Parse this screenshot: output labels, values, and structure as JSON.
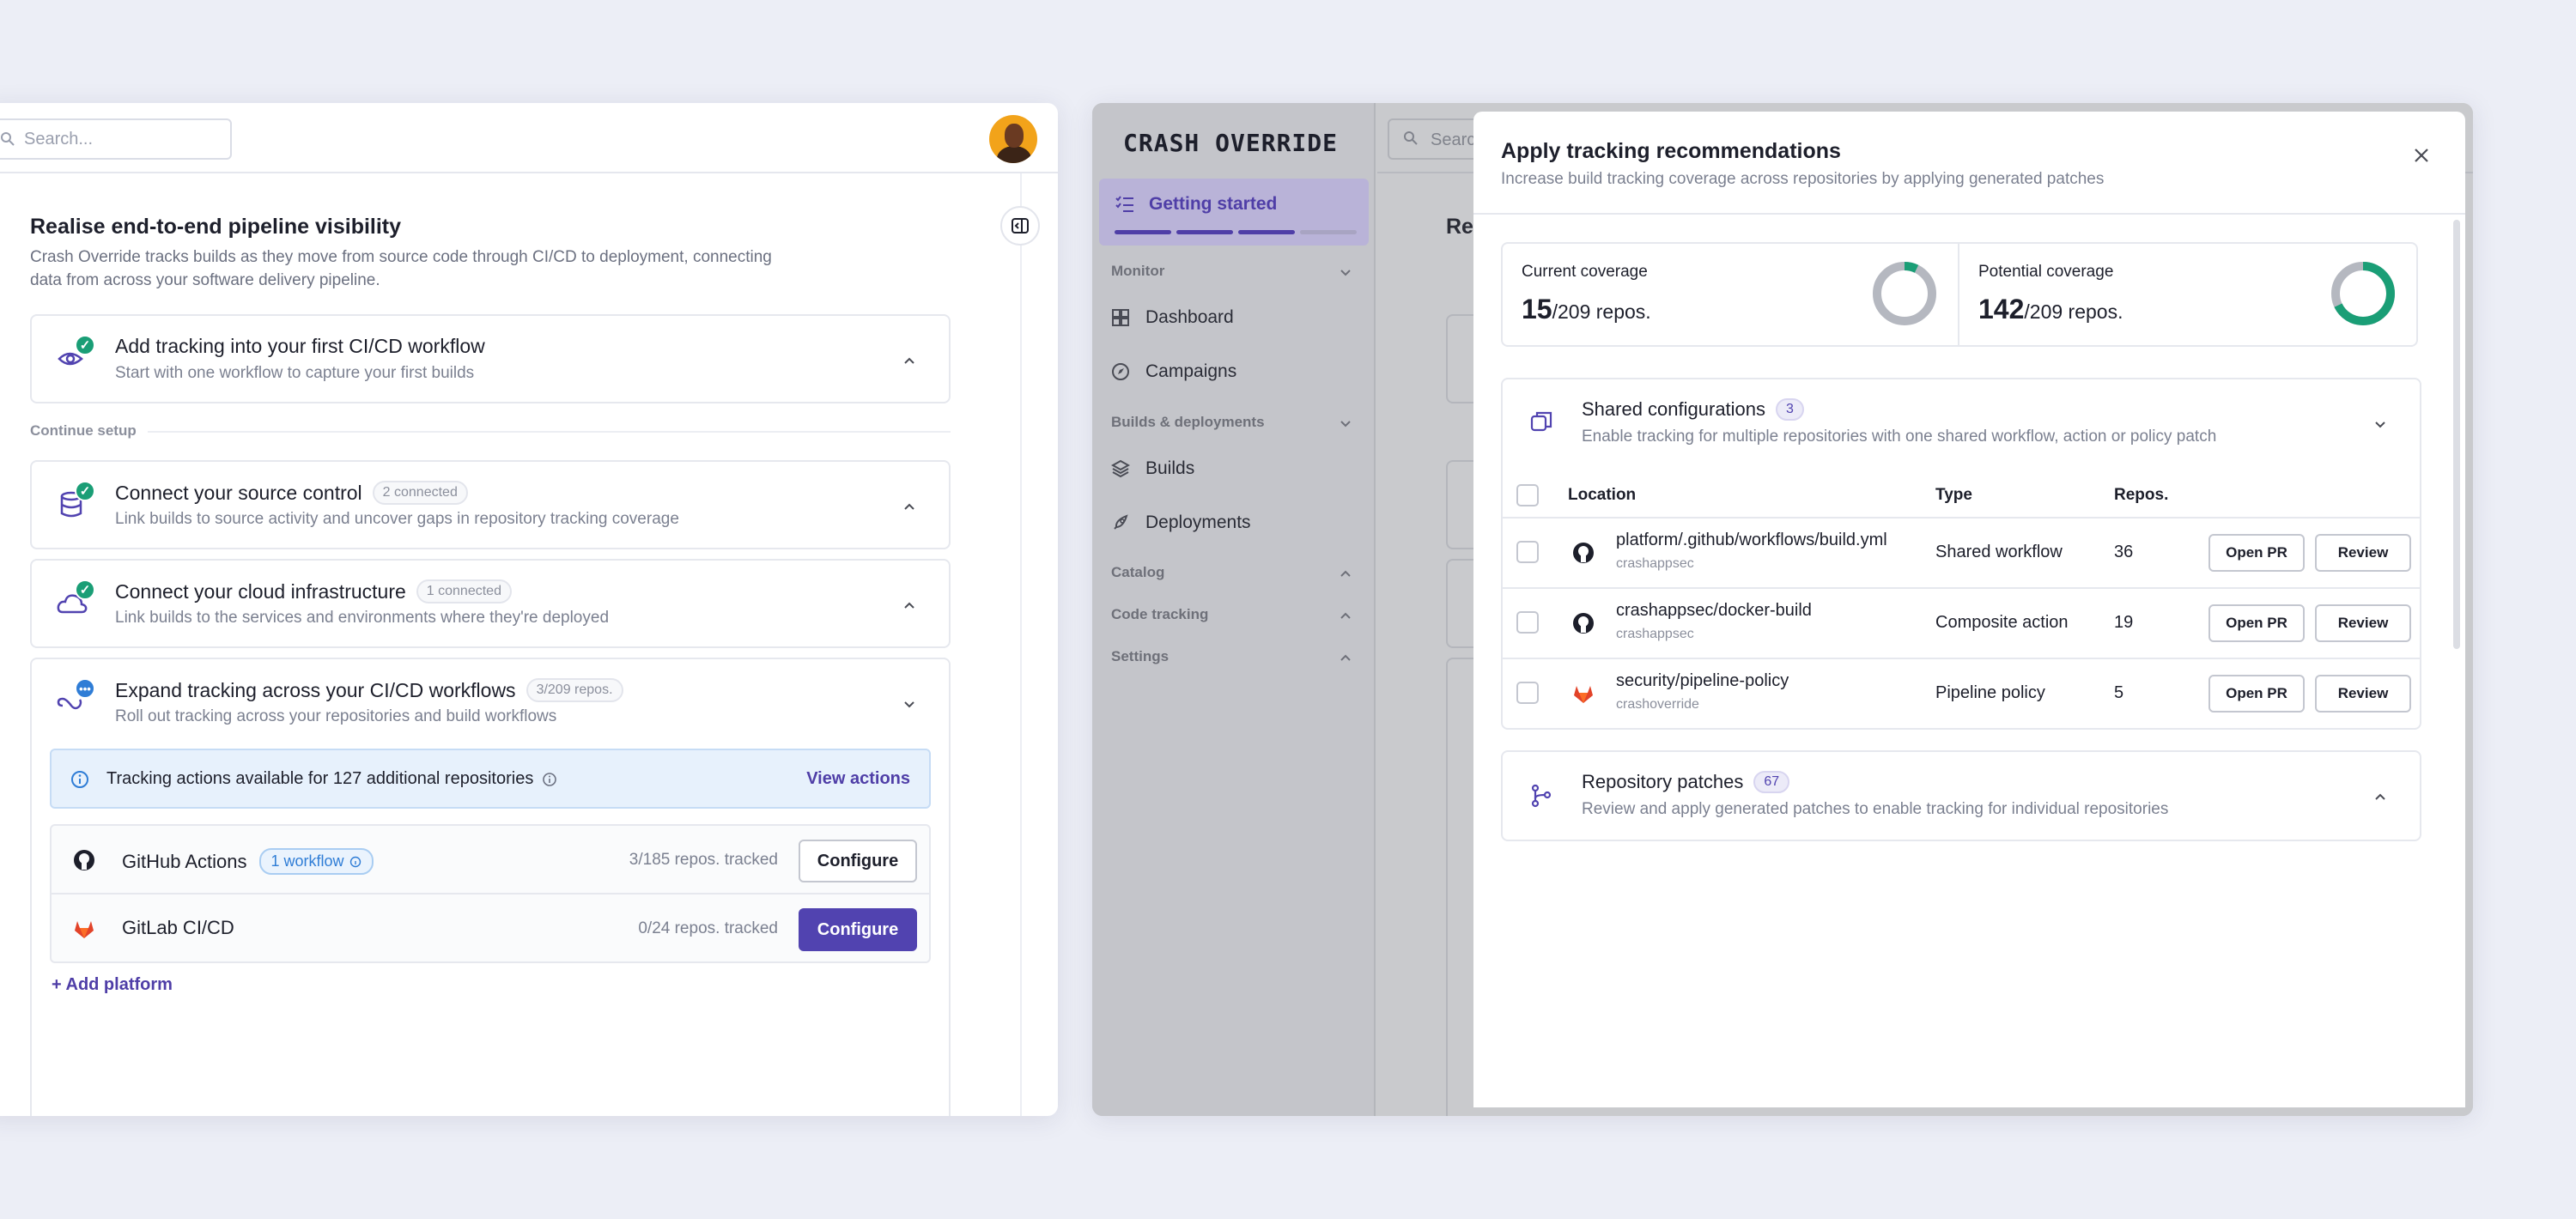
{
  "left": {
    "search_placeholder": "Search...",
    "title": "Realise end-to-end pipeline visibility",
    "description": "Crash Override tracks builds as they move from source code through CI/CD to deployment, connecting data from across your software delivery pipeline.",
    "first_card": {
      "title": "Add tracking into your first CI/CD workflow",
      "subtitle": "Start with one workflow to capture your first builds"
    },
    "continue_label": "Continue setup",
    "cards": [
      {
        "title": "Connect your source control",
        "badge": "2 connected",
        "subtitle": "Link builds to source activity and uncover gaps in repository tracking coverage"
      },
      {
        "title": "Connect your cloud infrastructure",
        "badge": "1 connected",
        "subtitle": "Link builds to the services and environments where they're deployed"
      },
      {
        "title": "Expand tracking across your CI/CD workflows",
        "badge": "3/209 repos.",
        "subtitle": "Roll out tracking across your repositories and build workflows"
      }
    ],
    "info": {
      "text": "Tracking actions available for 127 additional repositories",
      "action": "View actions"
    },
    "platforms": [
      {
        "name": "GitHub Actions",
        "badge": "1 workflow",
        "status": "3/185 repos. tracked",
        "button": "Configure"
      },
      {
        "name": "GitLab CI/CD",
        "status": "0/24 repos. tracked",
        "button": "Configure"
      }
    ],
    "add_platform": "Add platform"
  },
  "right": {
    "logo": "CRASH OVERRIDE",
    "search_placeholder": "Search",
    "bg_title": "Rea",
    "sidebar": {
      "getting_started": "Getting started",
      "monitor": "Monitor",
      "dashboard": "Dashboard",
      "campaigns": "Campaigns",
      "builds_deployments": "Builds & deployments",
      "builds": "Builds",
      "deployments": "Deployments",
      "catalog": "Catalog",
      "code_tracking": "Code tracking",
      "settings": "Settings"
    },
    "modal": {
      "title": "Apply tracking recommendations",
      "subtitle": "Increase build tracking coverage across repositories by applying generated patches",
      "current": {
        "label": "Current coverage",
        "value": "15",
        "total": "/209 repos.",
        "fraction": 0.072
      },
      "potential": {
        "label": "Potential coverage",
        "value": "142",
        "total": "/209 repos.",
        "fraction": 0.679
      },
      "shared": {
        "title": "Shared configurations",
        "count": "3",
        "subtitle": "Enable tracking for multiple repositories with one shared workflow, action or policy patch"
      },
      "columns": {
        "location": "Location",
        "type": "Type",
        "repos": "Repos."
      },
      "rows": [
        {
          "location": "platform/.github/workflows/build.yml",
          "owner": "crashappsec",
          "type": "Shared workflow",
          "repos": "36",
          "open": "Open PR",
          "review": "Review",
          "icon": "github-icon"
        },
        {
          "location": "crashappsec/docker-build",
          "owner": "crashappsec",
          "type": "Composite action",
          "repos": "19",
          "open": "Open PR",
          "review": "Review",
          "icon": "github-icon"
        },
        {
          "location": "security/pipeline-policy",
          "owner": "crashoverride",
          "type": "Pipeline policy",
          "repos": "5",
          "open": "Open PR",
          "review": "Review",
          "icon": "gitlab-icon"
        }
      ],
      "patches": {
        "title": "Repository patches",
        "count": "67",
        "subtitle": "Review and apply generated patches to enable tracking for individual repositories"
      }
    }
  },
  "colors": {
    "accent": "#5143b0",
    "success": "#1a9e76",
    "info": "#2f7dd6",
    "gitlab": "#e24329"
  }
}
